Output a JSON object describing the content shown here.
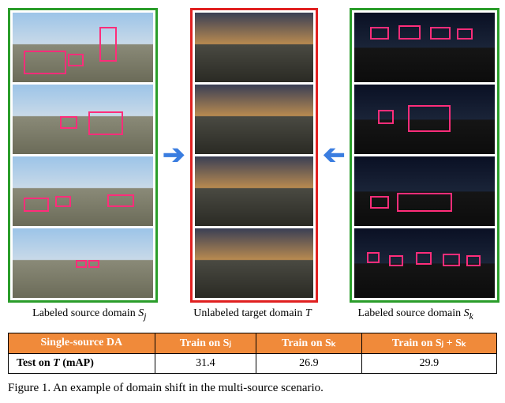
{
  "captions": {
    "left_a": "Labeled source domain ",
    "left_b": "S",
    "left_c": "j",
    "mid": "Unlabeled target domain ",
    "mid_b": "T",
    "right_a": "Labeled source domain ",
    "right_b": "S",
    "right_c": "k"
  },
  "table": {
    "headers": [
      "Single-source DA",
      "Train on Sⱼ",
      "Train on Sₖ",
      "Train on Sⱼ + Sₖ"
    ],
    "row_label": "Test on T (mAP)",
    "values": [
      "31.4",
      "26.9",
      "29.9"
    ]
  },
  "figure_caption": "Figure 1. An example of domain shift in the multi-source scenario."
}
